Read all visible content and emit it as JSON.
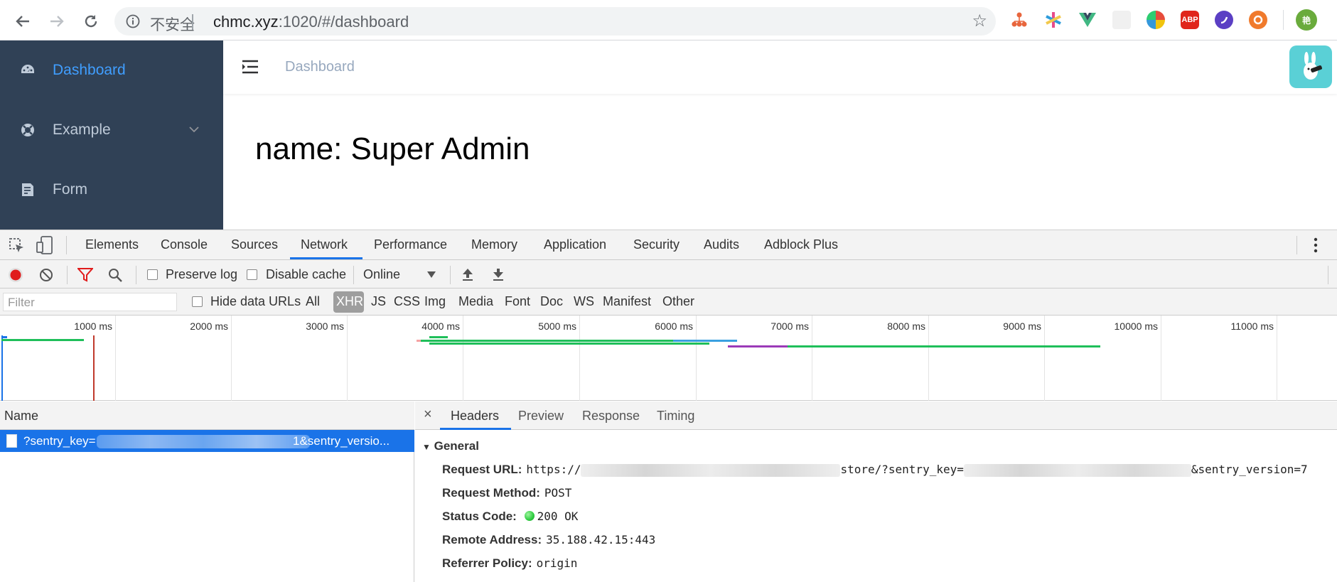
{
  "browser": {
    "insecure_label": "不安全",
    "separator": "|",
    "url_host": "chmc.xyz",
    "url_path": ":1020/#/dashboard",
    "profile_initial": "艳",
    "abp_label": "ABP"
  },
  "sidebar": {
    "items": [
      {
        "label": "Dashboard",
        "icon": "dashboard-icon",
        "active": true
      },
      {
        "label": "Example",
        "icon": "lifebuoy-icon",
        "active": false
      },
      {
        "label": "Form",
        "icon": "form-icon",
        "active": false
      }
    ]
  },
  "navbar": {
    "breadcrumb": "Dashboard"
  },
  "dashboard": {
    "name_text": "name: Super Admin"
  },
  "devtools": {
    "tabs": [
      "Elements",
      "Console",
      "Sources",
      "Network",
      "Performance",
      "Memory",
      "Application",
      "Security",
      "Audits",
      "Adblock Plus"
    ],
    "selected_tab": "Network",
    "toolbar": {
      "preserve_log": "Preserve log",
      "disable_cache": "Disable cache",
      "throttle": "Online"
    },
    "filter": {
      "placeholder": "Filter",
      "hide_data_urls": "Hide data URLs",
      "types": [
        "All",
        "XHR",
        "JS",
        "CSS",
        "Img",
        "Media",
        "Font",
        "Doc",
        "WS",
        "Manifest",
        "Other"
      ],
      "selected_type": "XHR"
    },
    "timeline": {
      "ticks": [
        "1000 ms",
        "2000 ms",
        "3000 ms",
        "4000 ms",
        "5000 ms",
        "6000 ms",
        "7000 ms",
        "8000 ms",
        "9000 ms",
        "10000 ms",
        "11000 ms"
      ]
    },
    "request_list": {
      "column_name": "Name",
      "row_prefix": "?sentry_key=",
      "row_suffix": "1&sentry_versio..."
    },
    "detail": {
      "close": "×",
      "tabs": [
        "Headers",
        "Preview",
        "Response",
        "Timing"
      ],
      "section": "General",
      "request_url_label": "Request URL:",
      "request_url_prefix": "https://",
      "request_url_mid": "store/?sentry_key=",
      "request_url_suffix": "&sentry_version=7",
      "request_method_label": "Request Method:",
      "request_method": "POST",
      "status_code_label": "Status Code:",
      "status_code": "200 OK",
      "remote_address_label": "Remote Address:",
      "remote_address": "35.188.42.15:443",
      "referrer_policy_label": "Referrer Policy:",
      "referrer_policy": "origin"
    }
  },
  "colors": {
    "sidebar_bg": "#304156",
    "active_menu": "#409eff",
    "devtools_accent": "#1a73e8",
    "status_ok": "#2ecc40"
  }
}
